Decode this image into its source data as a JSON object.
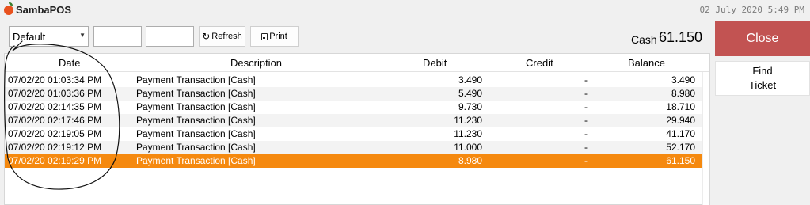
{
  "app": {
    "name": "SambaPOS",
    "clock": "02 July 2020 5:49 PM"
  },
  "toolbar": {
    "filter_value": "Default",
    "start_date_value": "",
    "end_date_value": "",
    "refresh_label": "Refresh",
    "print_label": "Print"
  },
  "summary": {
    "label": "Cash",
    "value": "61.150"
  },
  "actions": {
    "close_label": "Close",
    "find_ticket_label": "Find\nTicket"
  },
  "table": {
    "columns": [
      "Date",
      "Description",
      "Debit",
      "Credit",
      "Balance"
    ],
    "rows": [
      {
        "date": "07/02/20 01:03:34 PM",
        "description": "Payment Transaction [Cash]",
        "debit": "3.490",
        "credit": "-",
        "balance": "3.490"
      },
      {
        "date": "07/02/20 01:03:36 PM",
        "description": "Payment Transaction [Cash]",
        "debit": "5.490",
        "credit": "-",
        "balance": "8.980"
      },
      {
        "date": "07/02/20 02:14:35 PM",
        "description": "Payment Transaction [Cash]",
        "debit": "9.730",
        "credit": "-",
        "balance": "18.710"
      },
      {
        "date": "07/02/20 02:17:46 PM",
        "description": "Payment Transaction [Cash]",
        "debit": "11.230",
        "credit": "-",
        "balance": "29.940"
      },
      {
        "date": "07/02/20 02:19:05 PM",
        "description": "Payment Transaction [Cash]",
        "debit": "11.230",
        "credit": "-",
        "balance": "41.170"
      },
      {
        "date": "07/02/20 02:19:12 PM",
        "description": "Payment Transaction [Cash]",
        "debit": "11.000",
        "credit": "-",
        "balance": "52.170"
      },
      {
        "date": "07/02/20 02:19:29 PM",
        "description": "Payment Transaction [Cash]",
        "debit": "8.980",
        "credit": "-",
        "balance": "61.150"
      }
    ],
    "selected_row": 6
  },
  "icons": {
    "refresh": "refresh-icon",
    "print": "print-icon",
    "dropdown": "chevron-down-icon",
    "logo": "tomato-logo-icon"
  },
  "colors": {
    "close_button": "#c25352",
    "selected_row": "#f5890f",
    "logo": "#e8511d"
  }
}
